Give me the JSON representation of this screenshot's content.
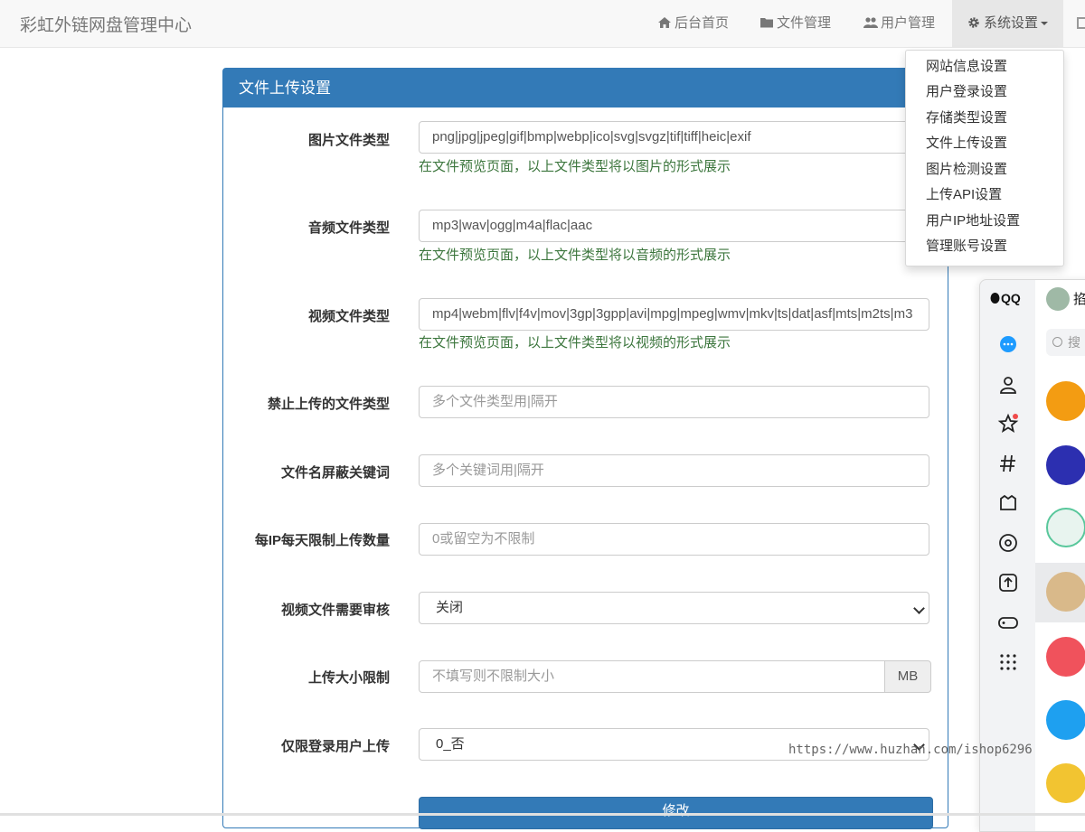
{
  "navbar": {
    "brand": "彩虹外链网盘管理中心",
    "items": [
      {
        "label": "后台首页",
        "icon": "home-icon"
      },
      {
        "label": "文件管理",
        "icon": "folder-icon"
      },
      {
        "label": "用户管理",
        "icon": "users-icon"
      },
      {
        "label": "系统设置",
        "icon": "gear-icon"
      }
    ]
  },
  "dropdown": {
    "items": [
      "网站信息设置",
      "用户登录设置",
      "存储类型设置",
      "文件上传设置",
      "图片检测设置",
      "上传API设置",
      "用户IP地址设置",
      "管理账号设置"
    ]
  },
  "panel": {
    "title": "文件上传设置",
    "fields": [
      {
        "label": "图片文件类型",
        "value": "png|jpg|jpeg|gif|bmp|webp|ico|svg|svgz|tif|tiff|heic|exif",
        "help": "在文件预览页面，以上文件类型将以图片的形式展示"
      },
      {
        "label": "音频文件类型",
        "value": "mp3|wav|ogg|m4a|flac|aac",
        "help": "在文件预览页面，以上文件类型将以音频的形式展示"
      },
      {
        "label": "视频文件类型",
        "value": "mp4|webm|flv|f4v|mov|3gp|3gpp|avi|mpg|mpeg|wmv|mkv|ts|dat|asf|mts|m2ts|m3",
        "help": "在文件预览页面，以上文件类型将以视频的形式展示"
      },
      {
        "label": "禁止上传的文件类型",
        "placeholder": "多个文件类型用|隔开"
      },
      {
        "label": "文件名屏蔽关键词",
        "placeholder": "多个关键词用|隔开"
      },
      {
        "label": "每IP每天限制上传数量",
        "placeholder": "0或留空为不限制"
      },
      {
        "label": "视频文件需要审核",
        "selected": "关闭"
      },
      {
        "label": "上传大小限制",
        "placeholder": "不填写则不限制大小",
        "addon": "MB"
      },
      {
        "label": "仅限登录用户上传",
        "selected": "0_否"
      }
    ],
    "submit_label": "修改"
  },
  "qq": {
    "logo": "QQ",
    "search_placeholder": "搜",
    "top_text": "掐"
  },
  "watermark": "https://www.huzhan.com/ishop6296",
  "colors": {
    "primary": "#337ab7",
    "help_text": "#3c763d"
  }
}
